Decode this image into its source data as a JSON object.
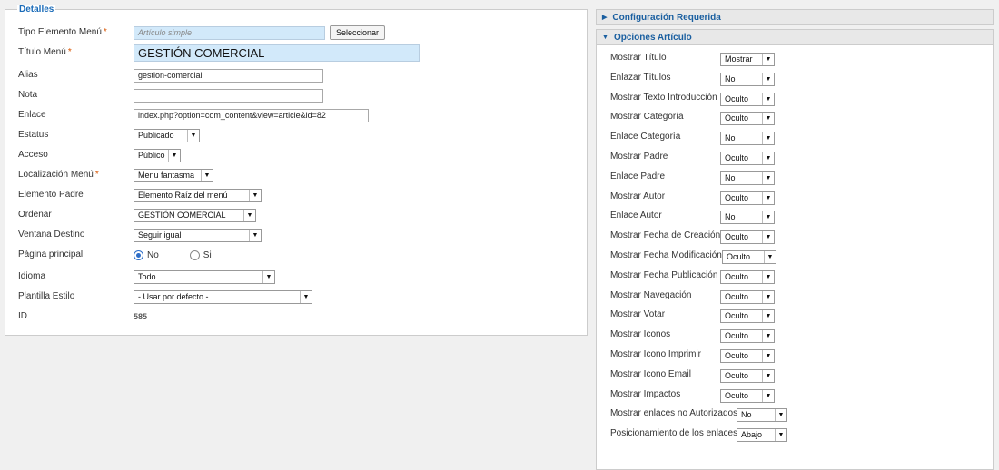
{
  "details": {
    "legend": "Detalles",
    "required_marker": "*",
    "menu_item_type": {
      "label": "Tipo Elemento Menú",
      "value": "Artículo simple",
      "button": "Seleccionar"
    },
    "menu_title": {
      "label": "Título Menú",
      "value": "GESTIÓN COMERCIAL"
    },
    "alias": {
      "label": "Alias",
      "value": "gestion-comercial"
    },
    "note": {
      "label": "Nota",
      "value": ""
    },
    "link": {
      "label": "Enlace",
      "value": "index.php?option=com_content&view=article&id=82"
    },
    "status": {
      "label": "Estatus",
      "value": "Publicado"
    },
    "access": {
      "label": "Acceso",
      "value": "Público"
    },
    "menu_location": {
      "label": "Localización Menú",
      "value": "Menu fantasma"
    },
    "parent_item": {
      "label": "Elemento Padre",
      "value": "Elemento Raíz del menú"
    },
    "ordering": {
      "label": "Ordenar",
      "value": "GESTIÓN COMERCIAL"
    },
    "target_window": {
      "label": "Ventana Destino",
      "value": "Seguir igual"
    },
    "home_page": {
      "label": "Página principal",
      "option_no": "No",
      "option_yes": "Si",
      "selected": "No"
    },
    "language": {
      "label": "Idioma",
      "value": "Todo"
    },
    "template_style": {
      "label": "Plantilla Estilo",
      "value": "- Usar por defecto -"
    },
    "id": {
      "label": "ID",
      "value": "585"
    }
  },
  "required_config": {
    "title": "Configuración Requerida"
  },
  "article_options": {
    "title": "Opciones Artículo",
    "rows": [
      {
        "label": "Mostrar Título",
        "value": "Mostrar"
      },
      {
        "label": "Enlazar Títulos",
        "value": "No"
      },
      {
        "label": "Mostrar Texto Introducción",
        "value": "Oculto"
      },
      {
        "label": "Mostrar Categoría",
        "value": "Oculto"
      },
      {
        "label": "Enlace Categoría",
        "value": "No"
      },
      {
        "label": "Mostrar Padre",
        "value": "Oculto"
      },
      {
        "label": "Enlace Padre",
        "value": "No"
      },
      {
        "label": "Mostrar Autor",
        "value": "Oculto"
      },
      {
        "label": "Enlace Autor",
        "value": "No"
      },
      {
        "label": "Mostrar Fecha de Creación",
        "value": "Oculto"
      },
      {
        "label": "Mostrar Fecha Modificación",
        "value": "Oculto"
      },
      {
        "label": "Mostrar Fecha Publicación",
        "value": "Oculto"
      },
      {
        "label": "Mostrar Navegación",
        "value": "Oculto"
      },
      {
        "label": "Mostrar Votar",
        "value": "Oculto"
      },
      {
        "label": "Mostrar Iconos",
        "value": "Oculto"
      },
      {
        "label": "Mostrar Icono Imprimir",
        "value": "Oculto"
      },
      {
        "label": "Mostrar Icono Email",
        "value": "Oculto"
      },
      {
        "label": "Mostrar Impactos",
        "value": "Oculto"
      },
      {
        "label": "Mostrar enlaces no Autorizados",
        "value": "No"
      },
      {
        "label": "Posicionamiento de los enlaces",
        "value": "Abajo"
      }
    ]
  },
  "colors": {
    "accent": "#1a6bb8",
    "required": "#d95500",
    "input_highlight": "#d2e9fa"
  }
}
